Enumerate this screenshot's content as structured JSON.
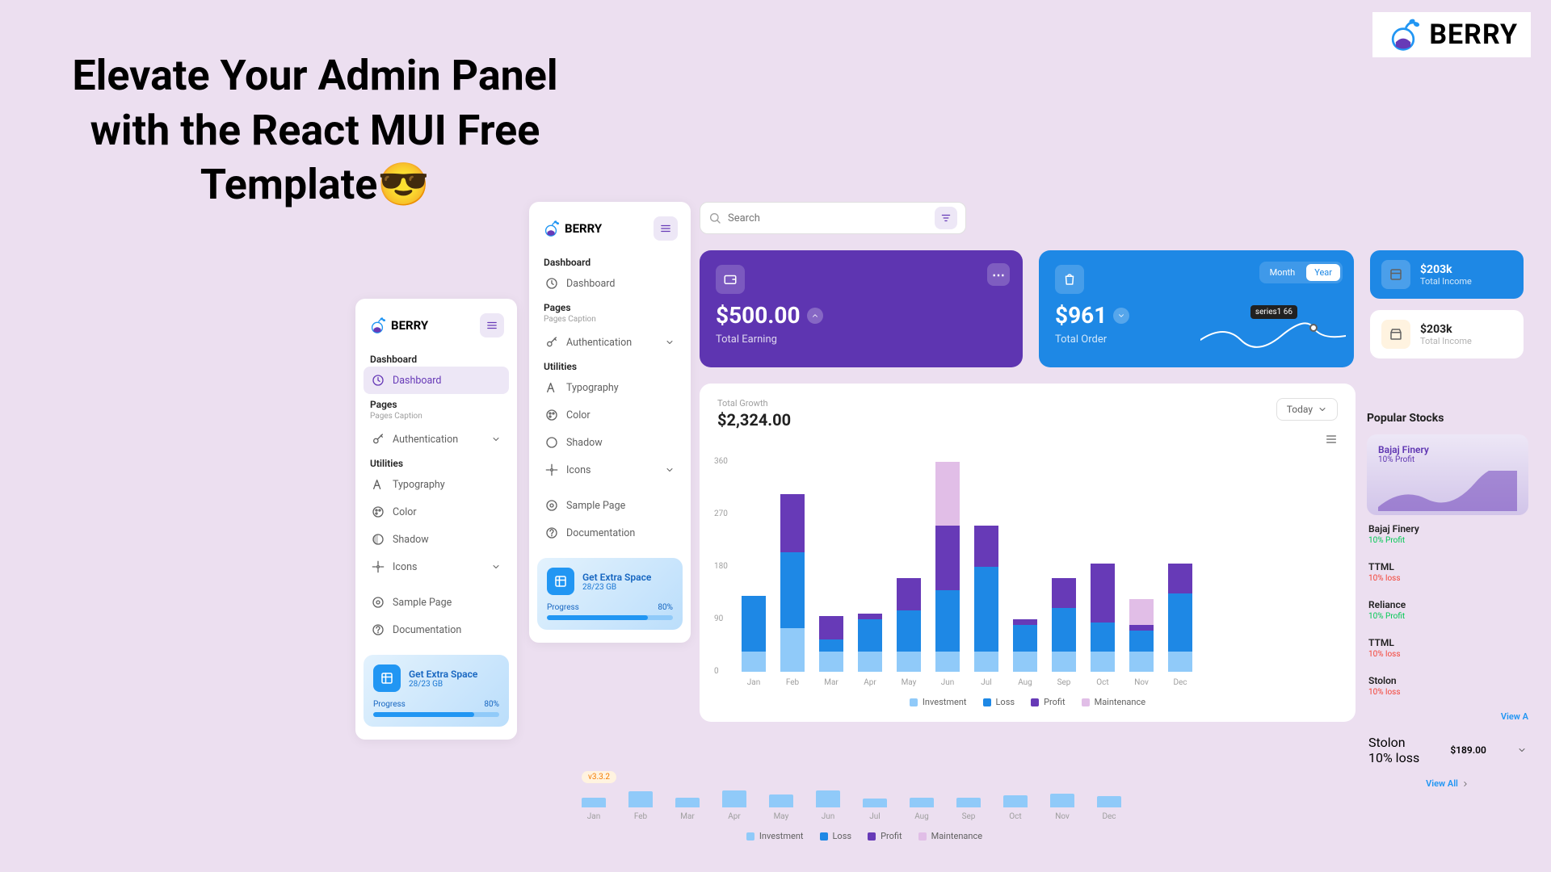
{
  "page_title": "Elevate Your Admin Panel with the React MUI Free Template😎",
  "brand": "BERRY",
  "search": {
    "placeholder": "Search"
  },
  "sidebar": {
    "dash_group": "Dashboard",
    "dash_item": "Dashboard",
    "pages_group": "Pages",
    "pages_caption": "Pages Caption",
    "auth": "Authentication",
    "util_group": "Utilities",
    "typography": "Typography",
    "color": "Color",
    "shadow": "Shadow",
    "icons": "Icons",
    "sample": "Sample Page",
    "docs": "Documentation"
  },
  "promo": {
    "title": "Get Extra Space",
    "sub": "28/23 GB",
    "label": "Progress",
    "pct": "80%"
  },
  "cards": {
    "earning": {
      "value": "$500.00",
      "label": "Total Earning"
    },
    "order": {
      "value": "$961",
      "label": "Total Order",
      "month": "Month",
      "year": "Year",
      "tooltip": "series1 66"
    }
  },
  "minis": [
    {
      "value": "$203k",
      "label": "Total Income"
    },
    {
      "value": "$203k",
      "label": "Total Income"
    }
  ],
  "chart": {
    "title": "Total Growth",
    "value": "$2,324.00",
    "period": "Today",
    "legend": [
      "Investment",
      "Loss",
      "Profit",
      "Maintenance"
    ]
  },
  "chart_data": {
    "type": "bar",
    "categories": [
      "Jan",
      "Feb",
      "Mar",
      "Apr",
      "May",
      "Jun",
      "Jul",
      "Aug",
      "Sep",
      "Oct",
      "Nov",
      "Dec"
    ],
    "series": [
      {
        "name": "Investment",
        "values": [
          35,
          75,
          35,
          35,
          35,
          35,
          35,
          35,
          35,
          35,
          35,
          35
        ]
      },
      {
        "name": "Loss",
        "values": [
          95,
          130,
          20,
          55,
          70,
          105,
          145,
          45,
          75,
          50,
          35,
          100
        ]
      },
      {
        "name": "Profit",
        "values": [
          0,
          100,
          40,
          10,
          55,
          110,
          70,
          10,
          50,
          100,
          10,
          50
        ]
      },
      {
        "name": "Maintenance",
        "values": [
          0,
          0,
          0,
          0,
          0,
          110,
          0,
          0,
          0,
          0,
          45,
          0
        ]
      }
    ],
    "ylim": [
      0,
      360
    ],
    "yticks": [
      0,
      90,
      180,
      270,
      360
    ]
  },
  "mini_chart": {
    "version": "v3.3.2",
    "categories": [
      "Jan",
      "Feb",
      "Mar",
      "Apr",
      "May",
      "Jun",
      "Jul",
      "Aug",
      "Sep",
      "Oct",
      "Nov",
      "Dec"
    ],
    "legend": [
      "Investment",
      "Loss",
      "Profit",
      "Maintenance"
    ]
  },
  "stocks": {
    "title": "Popular Stocks",
    "feature": {
      "name": "Bajaj Finery",
      "sub": "10% Profit"
    },
    "items": [
      {
        "name": "Bajaj Finery",
        "change": "10% Profit",
        "dir": "up"
      },
      {
        "name": "TTML",
        "change": "10% loss",
        "dir": "dn"
      },
      {
        "name": "Reliance",
        "change": "10% Profit",
        "dir": "up"
      },
      {
        "name": "TTML",
        "change": "10% loss",
        "dir": "dn"
      },
      {
        "name": "Stolon",
        "change": "10% loss",
        "dir": "dn"
      }
    ],
    "extra": {
      "name": "Stolon",
      "change": "10% loss",
      "price": "$189.00"
    },
    "viewall": "View All",
    "viewa": "View A"
  }
}
